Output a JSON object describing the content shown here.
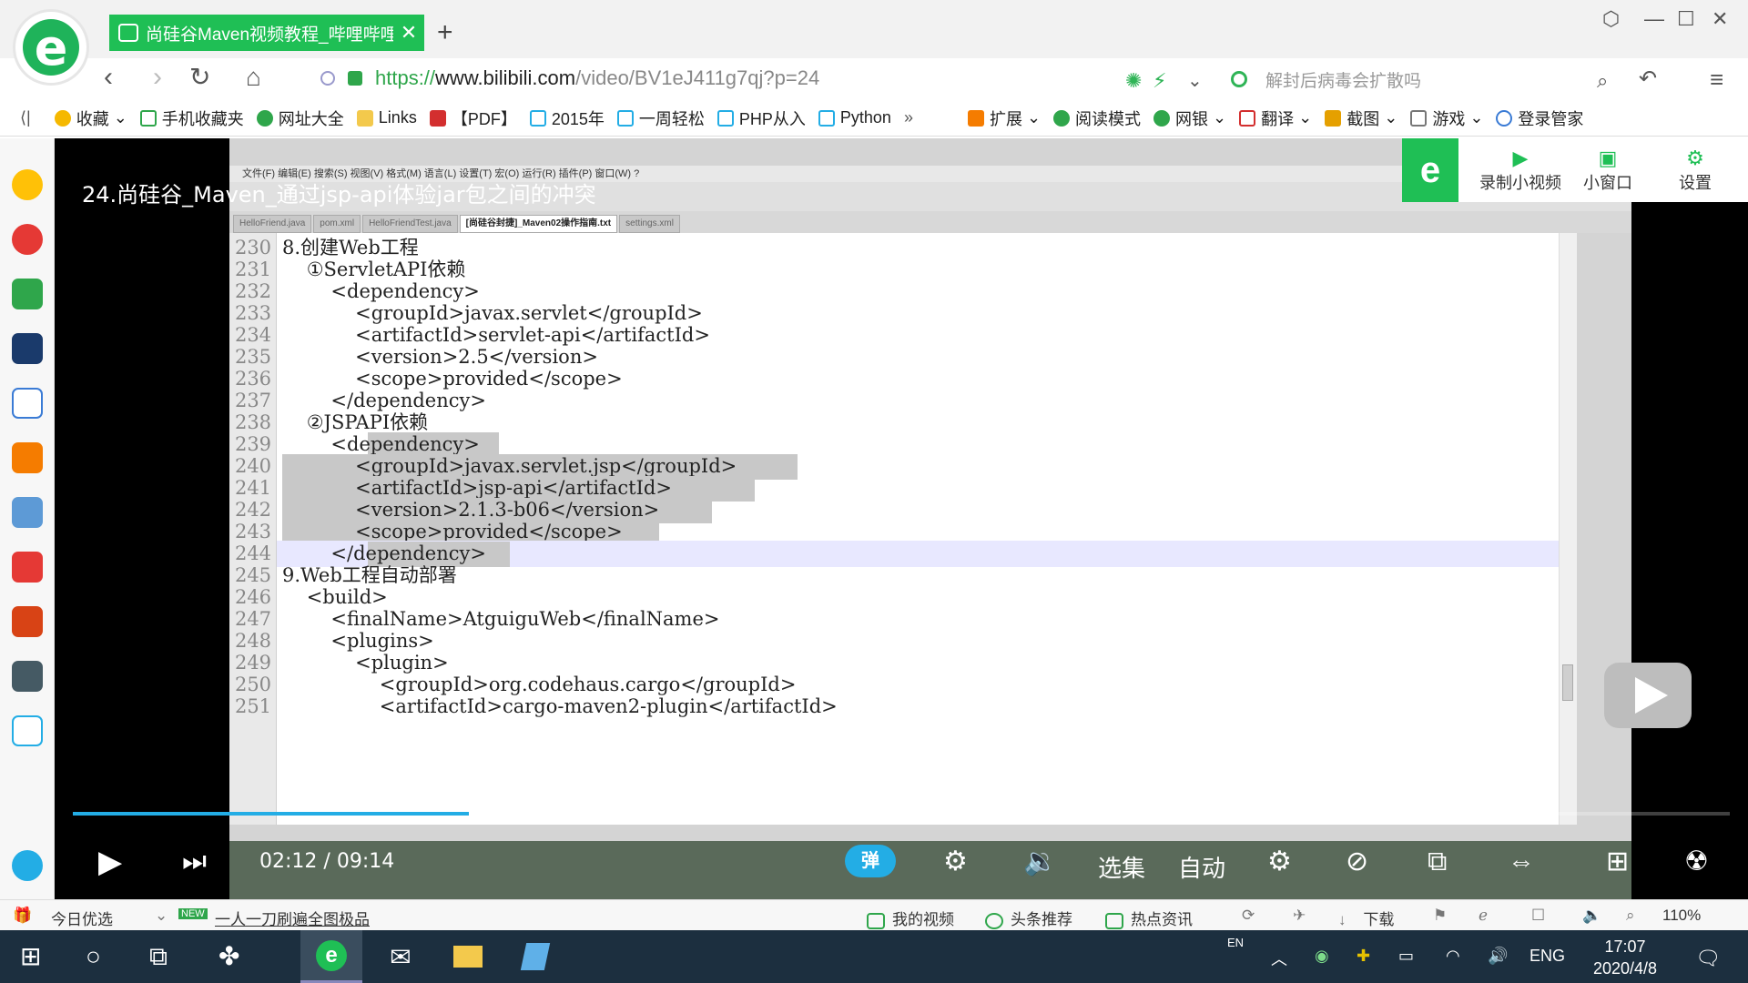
{
  "browser": {
    "tab_title": "尚硅谷Maven视频教程_哔哩哔哩",
    "url_scheme": "https://",
    "url_host": "www.bilibili.com",
    "url_path": "/video/BV1eJ411g7qj?p=24",
    "search_placeholder": "解封后病毒会扩散吗",
    "bookmarks": [
      "收藏",
      "手机收藏夹",
      "网址大全",
      "Links",
      "【PDF】",
      "2015年",
      "一周轻松",
      "PHP从入",
      "Python"
    ],
    "toolbar_right": [
      "扩展",
      "阅读模式",
      "网银",
      "翻译",
      "截图",
      "游戏",
      "登录管家"
    ]
  },
  "video": {
    "title": "24.尚硅谷_Maven_通过jsp-api体验jar包之间的冲突",
    "mini_panel": [
      "录制小视频",
      "小窗口",
      "设置"
    ],
    "time_current": "02:12",
    "time_separator": "/",
    "time_total": "09:14",
    "progress": 0.239,
    "danmu_label": "弹",
    "episodes_label": "选集",
    "auto_label": "自动"
  },
  "notepad": {
    "menu": "文件(F)   编辑(E)   搜索(S)   视图(V)   格式(M)   语言(L)   设置(T)   宏(O)   运行(R)   插件(P)   窗口(W)   ?",
    "tabs": [
      "HelloFriend.java",
      "pom.xml",
      "HelloFriendTest.java",
      "[尚硅谷封捷]_Maven02操作指南.txt",
      "settings.xml"
    ],
    "lines": [
      {
        "num": "230",
        "text": "8.创建Web工程"
      },
      {
        "num": "231",
        "text": "    ①ServletAPI依赖"
      },
      {
        "num": "232",
        "text": "        <dependency>"
      },
      {
        "num": "233",
        "text": "            <groupId>javax.servlet</groupId>"
      },
      {
        "num": "234",
        "text": "            <artifactId>servlet-api</artifactId>"
      },
      {
        "num": "235",
        "text": "            <version>2.5</version>"
      },
      {
        "num": "236",
        "text": "            <scope>provided</scope>"
      },
      {
        "num": "237",
        "text": "        </dependency>"
      },
      {
        "num": "238",
        "text": "    ②JSPAPI依赖"
      },
      {
        "num": "239",
        "text": "        <dependency>"
      },
      {
        "num": "240",
        "text": "            <groupId>javax.servlet.jsp</groupId>"
      },
      {
        "num": "241",
        "text": "            <artifactId>jsp-api</artifactId>"
      },
      {
        "num": "242",
        "text": "            <version>2.1.3-b06</version>"
      },
      {
        "num": "243",
        "text": "            <scope>provided</scope>"
      },
      {
        "num": "244",
        "text": "        </dependency>"
      },
      {
        "num": "245",
        "text": "9.Web工程自动部署"
      },
      {
        "num": "246",
        "text": "    <build>"
      },
      {
        "num": "247",
        "text": "        <finalName>AtguiguWeb</finalName>"
      },
      {
        "num": "248",
        "text": "        <plugins>"
      },
      {
        "num": "249",
        "text": "            <plugin>"
      },
      {
        "num": "250",
        "text": "                <groupId>org.codehaus.cargo</groupId>"
      },
      {
        "num": "251",
        "text": "                <artifactId>cargo-maven2-plugin</artifactId>"
      }
    ]
  },
  "statusbar": {
    "left": "今日优选",
    "new_badge": "NEW",
    "promo": "一人一刀刷遍全图极品",
    "items": [
      "我的视频",
      "头条推荐",
      "热点资讯",
      "下载"
    ],
    "zoom": "110%"
  },
  "taskbar": {
    "lang_small": "EN",
    "lang": "ENG",
    "time": "17:07",
    "date": "2020/4/8"
  }
}
